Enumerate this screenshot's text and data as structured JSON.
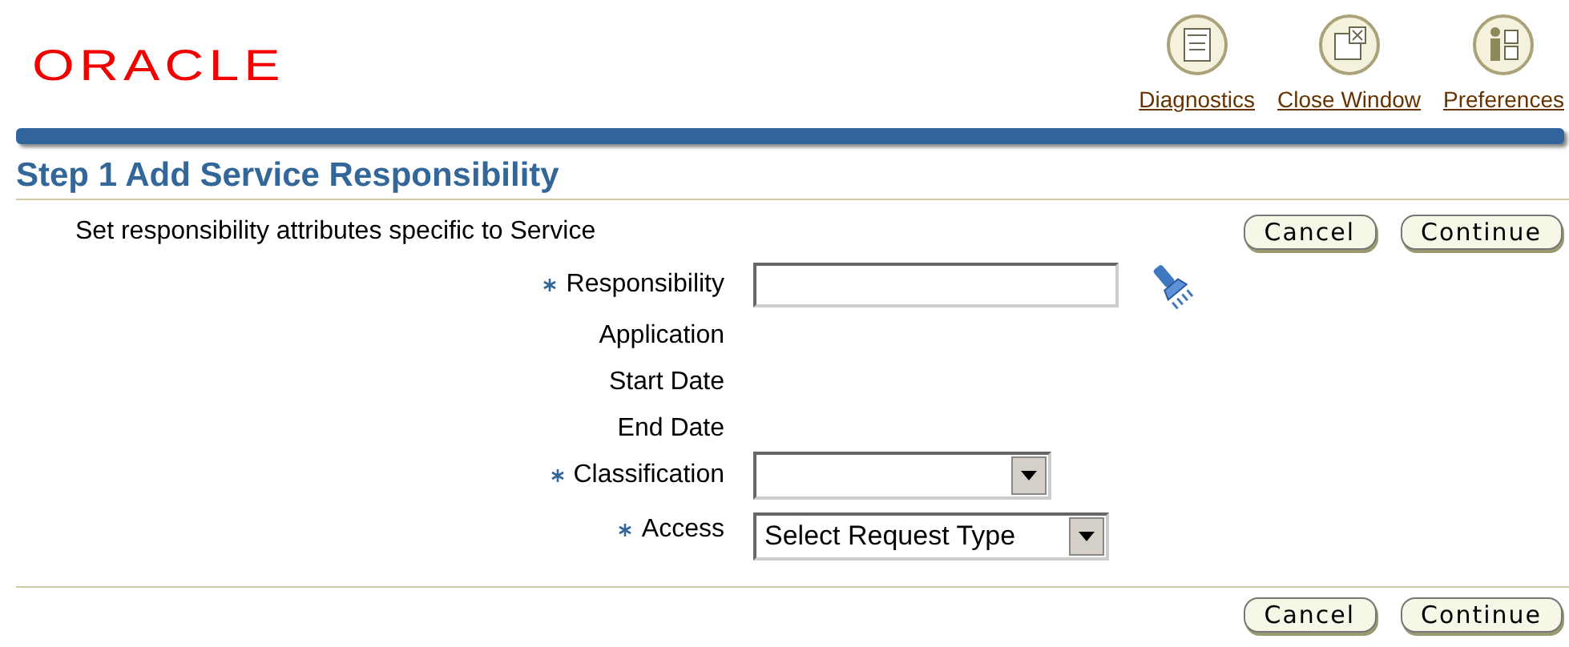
{
  "logo": "ORACLE",
  "global_links": [
    {
      "label": "Diagnostics"
    },
    {
      "label": "Close Window"
    },
    {
      "label": "Preferences"
    }
  ],
  "page_title": "Step 1 Add Service Responsibility",
  "instruction": "Set responsibility attributes specific to Service",
  "top_buttons": [
    "Cancel",
    "Continue"
  ],
  "fields": [
    {
      "label": "Responsibility",
      "required": true,
      "kind": "lov"
    },
    {
      "label": "Application",
      "required": false,
      "kind": "readonly"
    },
    {
      "label": "Start Date",
      "required": false,
      "kind": "readonly"
    },
    {
      "label": "End Date",
      "required": false,
      "kind": "readonly"
    },
    {
      "label": "Classification",
      "required": true,
      "kind": "select"
    },
    {
      "label": "Access",
      "required": true,
      "kind": "select",
      "value": "Select Request Type"
    }
  ],
  "bottom_buttons": [
    "Cancel",
    "Continue"
  ]
}
